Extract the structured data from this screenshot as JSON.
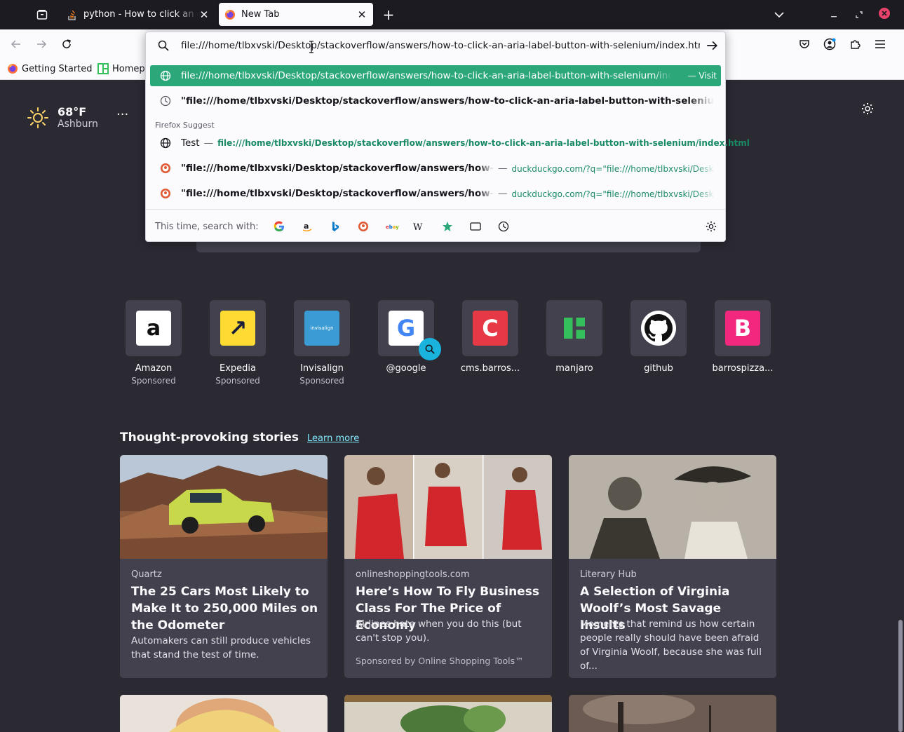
{
  "tabs": [
    {
      "title": "python - How to click an aria-label button with selenium",
      "active": false
    },
    {
      "title": "New Tab",
      "active": true
    }
  ],
  "urlbar": {
    "value": "file:///home/tlbxvski/Desktop/stackoverflow/answers/how-to-click-an-aria-label-button-with-selenium/index.html",
    "results": [
      {
        "text": "file:///home/tlbxvski/Desktop/stackoverflow/answers/how-to-click-an-aria-label-button-with-selenium/index.html",
        "action": "— Visit",
        "icon": "globe-icon"
      },
      {
        "text": "\"file:///home/tlbxvski/Desktop/stackoverflow/answers/how-to-click-an-aria-label-button-with-selenium/index.html\"",
        "icon": "history-icon"
      }
    ],
    "group_label": "Firefox Suggest",
    "suggest": [
      {
        "title": "Test",
        "sep": "—",
        "url": "file:///home/tlbxvski/Desktop/stackoverflow/answers/how-to-click-an-aria-label-button-with-selenium/index.html",
        "icon": "globe-icon"
      },
      {
        "title": "\"file:///home/tlbxvski/Desktop/stackoverflow/answers/how-to-c",
        "sep": "—",
        "url": "duckduckgo.com/?q=\"file:///home/tlbxvski/Desktop",
        "icon": "duckduckgo-icon"
      },
      {
        "title": "\"file:///home/tlbxvski/Desktop/stackoverflow/answers/how-to-c",
        "sep": "—",
        "url": "duckduckgo.com/?q=\"file:///home/tlbxvski/Desktop",
        "icon": "duckduckgo-icon"
      }
    ],
    "oneoff_label": "This time, search with:",
    "engines": [
      "google-icon",
      "amazon-icon",
      "bing-icon",
      "duckduckgo-icon",
      "ebay-icon",
      "wikipedia-icon",
      "bookmarks-star-icon",
      "tabs-icon",
      "history-clock-icon"
    ]
  },
  "bookmarks": [
    {
      "label": "Getting Started"
    },
    {
      "label": "Homepage"
    }
  ],
  "weather": {
    "temp": "68°F",
    "city": "Ashburn"
  },
  "top_sites": [
    {
      "name": "Amazon",
      "sponsored": "Sponsored",
      "logo_text": "a",
      "bg": "#ffffff",
      "fg": "#111111"
    },
    {
      "name": "Expedia",
      "sponsored": "Sponsored",
      "logo_text": "↗",
      "bg": "#fddb32",
      "fg": "#191e3b"
    },
    {
      "name": "Invisalign",
      "sponsored": "Sponsored",
      "logo_text": "invisalign",
      "bg": "#3a9bd5",
      "fg": "#ffffff"
    },
    {
      "name": "@google",
      "sponsored": "",
      "logo_text": "G",
      "bg": "#ffffff",
      "fg": "#4285f4"
    },
    {
      "name": "cms.barros...",
      "sponsored": "",
      "logo_text": "C",
      "bg": "#e63946",
      "fg": "#ffffff"
    },
    {
      "name": "manjaro",
      "sponsored": "",
      "logo_text": "M",
      "bg": "#42414d",
      "fg": "#35bf5c"
    },
    {
      "name": "github",
      "sponsored": "",
      "logo_text": "",
      "bg": "#ffffff",
      "fg": "#111111"
    },
    {
      "name": "barrospizza...",
      "sponsored": "",
      "logo_text": "B",
      "bg": "#f2287f",
      "fg": "#ffffff"
    }
  ],
  "stories": {
    "title": "Thought-provoking stories",
    "learn_more": "Learn more",
    "cards": [
      {
        "source": "Quartz",
        "headline": "The 25 Cars Most Likely to Make It to 250,000 Miles on the Odometer",
        "excerpt": "Automakers can still produce vehicles that stand the test of time.",
        "sponsor": ""
      },
      {
        "source": "onlineshoppingtools.com",
        "headline": "Here’s How To Fly Business Class For The Price of Economy",
        "excerpt": "Airlines hate when you do this (but can't stop you).",
        "sponsor": "Sponsored by Online Shopping Tools™"
      },
      {
        "source": "Literary Hub",
        "headline": "A Selection of Virginia Woolf’s Most Savage Insults",
        "excerpt": "Moments that remind us how certain people really should have been afraid of Virginia Woolf, because she was full of...",
        "sponsor": ""
      }
    ]
  },
  "colors": {
    "accent": "#2ba77a",
    "page_bg": "#2b2a33",
    "card_bg": "#42414d",
    "link": "#80ebff"
  }
}
